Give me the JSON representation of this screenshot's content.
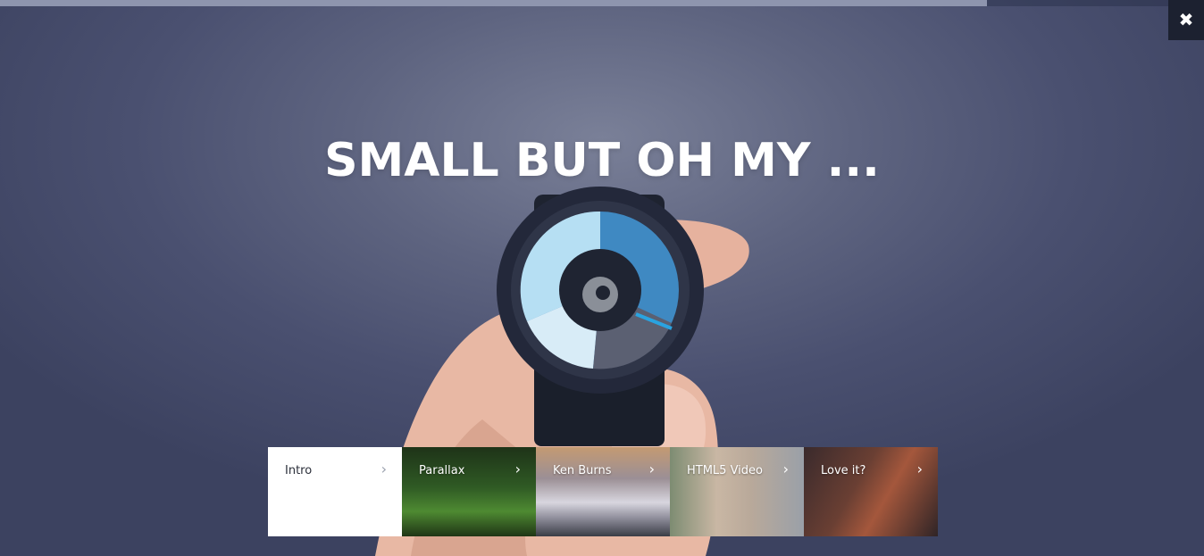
{
  "slide": {
    "headline": "SMALL BUT OH MY ...",
    "progress": 0.82
  },
  "close_button": {
    "label": "✖",
    "icon": "close-icon"
  },
  "thumbnails": [
    {
      "label": "Intro",
      "chevron": "›",
      "active": true
    },
    {
      "label": "Parallax",
      "chevron": "›",
      "active": false
    },
    {
      "label": "Ken Burns",
      "chevron": "›",
      "active": false
    },
    {
      "label": "HTML5 Video",
      "chevron": "›",
      "active": false
    },
    {
      "label": "Love it?",
      "chevron": "›",
      "active": false
    }
  ],
  "colors": {
    "background": "#5e6480",
    "progress_fill": "#8e95ae",
    "close_bg": "#1c2130",
    "watch_accent": "#2aa3e0"
  }
}
